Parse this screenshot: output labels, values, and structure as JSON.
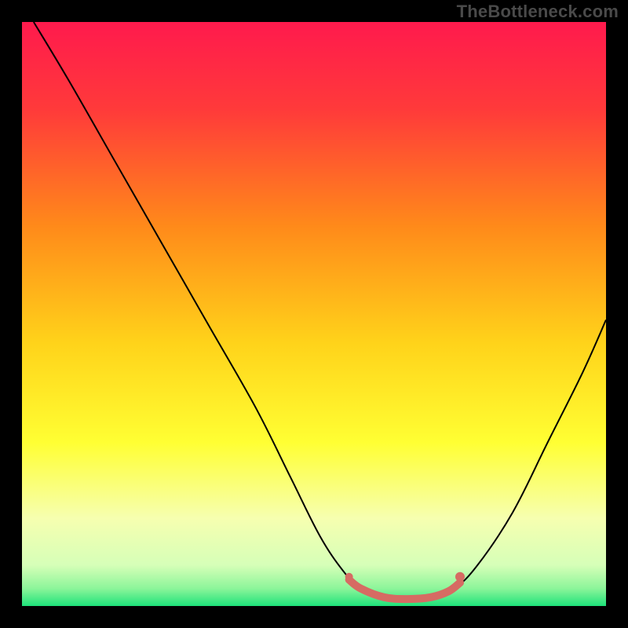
{
  "watermark": {
    "text": "TheBottleneck.com"
  },
  "chart_data": {
    "type": "line",
    "title": "",
    "xlabel": "",
    "ylabel": "",
    "xlim": [
      0,
      100
    ],
    "ylim": [
      0,
      100
    ],
    "grid": false,
    "legend": false,
    "background_gradient": {
      "type": "vertical",
      "stops": [
        {
          "offset": 0.0,
          "color": "#ff1a4d"
        },
        {
          "offset": 0.15,
          "color": "#ff3a3a"
        },
        {
          "offset": 0.35,
          "color": "#ff8a1a"
        },
        {
          "offset": 0.55,
          "color": "#ffd31a"
        },
        {
          "offset": 0.72,
          "color": "#ffff33"
        },
        {
          "offset": 0.85,
          "color": "#f6ffb0"
        },
        {
          "offset": 0.93,
          "color": "#d6ffb8"
        },
        {
          "offset": 0.97,
          "color": "#8cf59a"
        },
        {
          "offset": 1.0,
          "color": "#1ee27a"
        }
      ]
    },
    "series": [
      {
        "name": "bottleneck-curve",
        "color": "#000000",
        "stroke_width": 2,
        "points": [
          {
            "x": 2,
            "y": 100
          },
          {
            "x": 8,
            "y": 90
          },
          {
            "x": 16,
            "y": 76
          },
          {
            "x": 24,
            "y": 62
          },
          {
            "x": 32,
            "y": 48
          },
          {
            "x": 40,
            "y": 34
          },
          {
            "x": 46,
            "y": 22
          },
          {
            "x": 51,
            "y": 12
          },
          {
            "x": 55,
            "y": 6
          },
          {
            "x": 58,
            "y": 3
          },
          {
            "x": 62,
            "y": 1.5
          },
          {
            "x": 66,
            "y": 1.2
          },
          {
            "x": 70,
            "y": 1.5
          },
          {
            "x": 74,
            "y": 3
          },
          {
            "x": 78,
            "y": 7
          },
          {
            "x": 84,
            "y": 16
          },
          {
            "x": 90,
            "y": 28
          },
          {
            "x": 96,
            "y": 40
          },
          {
            "x": 100,
            "y": 49
          }
        ]
      },
      {
        "name": "optimal-range-highlight",
        "color": "#d66b63",
        "stroke_width": 10,
        "points": [
          {
            "x": 56,
            "y": 4.5
          },
          {
            "x": 58,
            "y": 3
          },
          {
            "x": 62,
            "y": 1.5
          },
          {
            "x": 66,
            "y": 1.2
          },
          {
            "x": 70,
            "y": 1.5
          },
          {
            "x": 73,
            "y": 2.5
          },
          {
            "x": 75,
            "y": 4
          }
        ]
      }
    ],
    "markers": [
      {
        "name": "marker-left",
        "x": 56,
        "y": 5,
        "r": 5,
        "color": "#d66b63"
      },
      {
        "name": "marker-right",
        "x": 75,
        "y": 5,
        "r": 6,
        "color": "#d66b63"
      }
    ]
  }
}
